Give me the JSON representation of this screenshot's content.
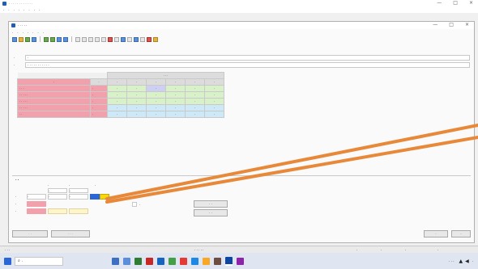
{
  "outer_window": {
    "title": "· · · · · · · · · · · ·",
    "menu": [
      "·",
      "·",
      "·",
      "·",
      "·",
      "·",
      "·",
      "·"
    ],
    "controls": [
      "—",
      "□",
      "×"
    ]
  },
  "inner_window": {
    "title": "· · · · ·",
    "menu": [
      "·",
      "·",
      "·",
      "·",
      "·",
      "·",
      "·"
    ],
    "controls": [
      "—",
      "□",
      "×"
    ]
  },
  "filter": {
    "rows": [
      {
        "label": "·",
        "value": "·"
      },
      {
        "label": "·",
        "value": "· · · · · · · · · · ·"
      }
    ]
  },
  "main_table": {
    "group_header": "· · ·",
    "header_left": [
      "·",
      "·"
    ],
    "columns": [
      "·",
      "·",
      "·",
      "·",
      "·",
      "·"
    ],
    "rows": [
      {
        "label": "· · ·",
        "unit": "·",
        "values": [
          "·",
          "·",
          "·",
          "·",
          "·",
          "·"
        ],
        "tint": "g"
      },
      {
        "label": "· · · · ·",
        "unit": "·",
        "values": [
          "·",
          "·",
          "·",
          "·",
          "·",
          "·"
        ],
        "tint": "g"
      },
      {
        "label": "· · · · ·",
        "unit": "·",
        "values": [
          "·",
          "·",
          "·",
          "·",
          "·",
          "·"
        ],
        "tint": "g"
      },
      {
        "label": "· · · · ·",
        "unit": "·",
        "values": [
          "·",
          "·",
          "·",
          "·",
          "·",
          "·"
        ],
        "tint": "b"
      },
      {
        "label": "· ·",
        "unit": "·",
        "values": [
          "·",
          "·",
          "·",
          "·",
          "·",
          "·"
        ],
        "tint": "b"
      }
    ]
  },
  "interp_panel": {
    "title": "· ·",
    "col_headers": [
      "·",
      "·",
      "·"
    ],
    "sub_headers": [
      "·",
      "·"
    ],
    "rows": [
      {
        "label": "·",
        "values": [
          "·",
          "·",
          "·"
        ]
      },
      {
        "label": "·",
        "values": [
          "",
          "",
          ""
        ]
      },
      {
        "label": "·",
        "values": [
          "",
          "",
          ""
        ]
      }
    ],
    "checkbox_label": "·",
    "button_1": "· ·",
    "button_2": "· ·"
  },
  "bottom_buttons": {
    "left_1": "· ·",
    "left_2": "· · ·",
    "right_1": "·",
    "right_2": "·"
  },
  "status_bar": {
    "left": "· · ·",
    "center": "· · · · ·",
    "right_items": [
      "·",
      "·",
      "·",
      "·"
    ]
  },
  "taskbar": {
    "search": "·",
    "tray": "· · ·",
    "clock": "·"
  },
  "colors": {
    "pink": "#f3a0ad",
    "green_cell": "#d8f1c8",
    "blue_cell": "#cde8f6",
    "highlight_cell": "#2a66d6",
    "yellow_cell": "#f5d90a",
    "arrow": "#e8893a"
  }
}
